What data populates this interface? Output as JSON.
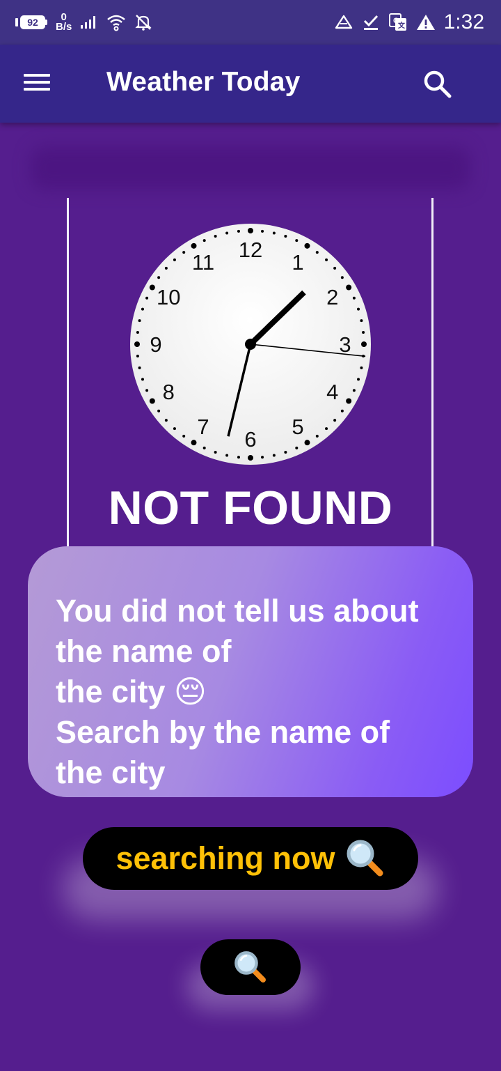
{
  "status_bar": {
    "battery_level": "92",
    "net_speed_value": "0",
    "net_speed_unit": "B/s",
    "time": "1:32",
    "icons": [
      "battery-icon",
      "signal-icon",
      "wifi-icon",
      "notifications-off-icon",
      "drive-icon",
      "check-icon",
      "translate-icon",
      "warning-icon"
    ]
  },
  "app_bar": {
    "title": "Weather Today",
    "menu_icon": "menu-icon",
    "search_icon": "search-icon"
  },
  "clock": {
    "numerals": [
      "12",
      "1",
      "2",
      "3",
      "4",
      "5",
      "6",
      "7",
      "8",
      "9",
      "10",
      "11"
    ],
    "hour": 1,
    "minute": 32,
    "second": 16
  },
  "main": {
    "status_title": "NOT FOUND",
    "message": "You did not tell us about the name of the city 😔 Search by the name of the city",
    "search_button_label": "searching now",
    "search_button_icon": "magnifier-icon",
    "fab_icon": "magnifier-icon"
  },
  "colors": {
    "background": "#551e8e",
    "app_bar": "#35268a",
    "status_bar": "#3f3285",
    "button_text": "#ffc107",
    "card_gradient_start": "#b49ad6",
    "card_gradient_end": "#7c4dff"
  }
}
